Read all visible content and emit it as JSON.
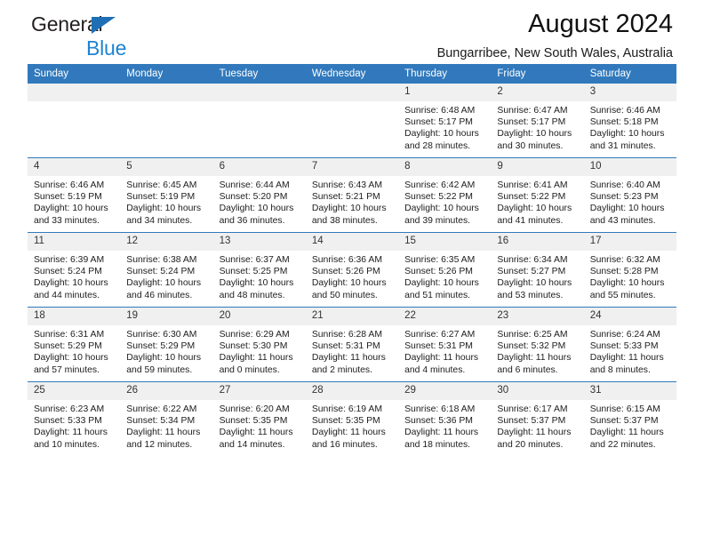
{
  "brand": {
    "name_part1": "General",
    "name_part2": "Blue",
    "logo_icon": "triangle-logo-icon",
    "accent_color": "#1f83d0"
  },
  "header": {
    "title": "August 2024",
    "subtitle": "Bungarribee, New South Wales, Australia"
  },
  "calendar": {
    "header_background": "#3179bc",
    "daynum_background": "#f0f0f0",
    "weekday_headers": [
      "Sunday",
      "Monday",
      "Tuesday",
      "Wednesday",
      "Thursday",
      "Friday",
      "Saturday"
    ],
    "labels": {
      "sunrise_prefix": "Sunrise: ",
      "sunset_prefix": "Sunset: ",
      "daylight_prefix": "Daylight: "
    },
    "weeks": [
      [
        {
          "day": "",
          "sunrise": "",
          "sunset": "",
          "daylight": "",
          "blank": true
        },
        {
          "day": "",
          "sunrise": "",
          "sunset": "",
          "daylight": "",
          "blank": true
        },
        {
          "day": "",
          "sunrise": "",
          "sunset": "",
          "daylight": "",
          "blank": true
        },
        {
          "day": "",
          "sunrise": "",
          "sunset": "",
          "daylight": "",
          "blank": true
        },
        {
          "day": "1",
          "sunrise": "Sunrise: 6:48 AM",
          "sunset": "Sunset: 5:17 PM",
          "daylight": "Daylight: 10 hours and 28 minutes."
        },
        {
          "day": "2",
          "sunrise": "Sunrise: 6:47 AM",
          "sunset": "Sunset: 5:17 PM",
          "daylight": "Daylight: 10 hours and 30 minutes."
        },
        {
          "day": "3",
          "sunrise": "Sunrise: 6:46 AM",
          "sunset": "Sunset: 5:18 PM",
          "daylight": "Daylight: 10 hours and 31 minutes."
        }
      ],
      [
        {
          "day": "4",
          "sunrise": "Sunrise: 6:46 AM",
          "sunset": "Sunset: 5:19 PM",
          "daylight": "Daylight: 10 hours and 33 minutes."
        },
        {
          "day": "5",
          "sunrise": "Sunrise: 6:45 AM",
          "sunset": "Sunset: 5:19 PM",
          "daylight": "Daylight: 10 hours and 34 minutes."
        },
        {
          "day": "6",
          "sunrise": "Sunrise: 6:44 AM",
          "sunset": "Sunset: 5:20 PM",
          "daylight": "Daylight: 10 hours and 36 minutes."
        },
        {
          "day": "7",
          "sunrise": "Sunrise: 6:43 AM",
          "sunset": "Sunset: 5:21 PM",
          "daylight": "Daylight: 10 hours and 38 minutes."
        },
        {
          "day": "8",
          "sunrise": "Sunrise: 6:42 AM",
          "sunset": "Sunset: 5:22 PM",
          "daylight": "Daylight: 10 hours and 39 minutes."
        },
        {
          "day": "9",
          "sunrise": "Sunrise: 6:41 AM",
          "sunset": "Sunset: 5:22 PM",
          "daylight": "Daylight: 10 hours and 41 minutes."
        },
        {
          "day": "10",
          "sunrise": "Sunrise: 6:40 AM",
          "sunset": "Sunset: 5:23 PM",
          "daylight": "Daylight: 10 hours and 43 minutes."
        }
      ],
      [
        {
          "day": "11",
          "sunrise": "Sunrise: 6:39 AM",
          "sunset": "Sunset: 5:24 PM",
          "daylight": "Daylight: 10 hours and 44 minutes."
        },
        {
          "day": "12",
          "sunrise": "Sunrise: 6:38 AM",
          "sunset": "Sunset: 5:24 PM",
          "daylight": "Daylight: 10 hours and 46 minutes."
        },
        {
          "day": "13",
          "sunrise": "Sunrise: 6:37 AM",
          "sunset": "Sunset: 5:25 PM",
          "daylight": "Daylight: 10 hours and 48 minutes."
        },
        {
          "day": "14",
          "sunrise": "Sunrise: 6:36 AM",
          "sunset": "Sunset: 5:26 PM",
          "daylight": "Daylight: 10 hours and 50 minutes."
        },
        {
          "day": "15",
          "sunrise": "Sunrise: 6:35 AM",
          "sunset": "Sunset: 5:26 PM",
          "daylight": "Daylight: 10 hours and 51 minutes."
        },
        {
          "day": "16",
          "sunrise": "Sunrise: 6:34 AM",
          "sunset": "Sunset: 5:27 PM",
          "daylight": "Daylight: 10 hours and 53 minutes."
        },
        {
          "day": "17",
          "sunrise": "Sunrise: 6:32 AM",
          "sunset": "Sunset: 5:28 PM",
          "daylight": "Daylight: 10 hours and 55 minutes."
        }
      ],
      [
        {
          "day": "18",
          "sunrise": "Sunrise: 6:31 AM",
          "sunset": "Sunset: 5:29 PM",
          "daylight": "Daylight: 10 hours and 57 minutes."
        },
        {
          "day": "19",
          "sunrise": "Sunrise: 6:30 AM",
          "sunset": "Sunset: 5:29 PM",
          "daylight": "Daylight: 10 hours and 59 minutes."
        },
        {
          "day": "20",
          "sunrise": "Sunrise: 6:29 AM",
          "sunset": "Sunset: 5:30 PM",
          "daylight": "Daylight: 11 hours and 0 minutes."
        },
        {
          "day": "21",
          "sunrise": "Sunrise: 6:28 AM",
          "sunset": "Sunset: 5:31 PM",
          "daylight": "Daylight: 11 hours and 2 minutes."
        },
        {
          "day": "22",
          "sunrise": "Sunrise: 6:27 AM",
          "sunset": "Sunset: 5:31 PM",
          "daylight": "Daylight: 11 hours and 4 minutes."
        },
        {
          "day": "23",
          "sunrise": "Sunrise: 6:25 AM",
          "sunset": "Sunset: 5:32 PM",
          "daylight": "Daylight: 11 hours and 6 minutes."
        },
        {
          "day": "24",
          "sunrise": "Sunrise: 6:24 AM",
          "sunset": "Sunset: 5:33 PM",
          "daylight": "Daylight: 11 hours and 8 minutes."
        }
      ],
      [
        {
          "day": "25",
          "sunrise": "Sunrise: 6:23 AM",
          "sunset": "Sunset: 5:33 PM",
          "daylight": "Daylight: 11 hours and 10 minutes."
        },
        {
          "day": "26",
          "sunrise": "Sunrise: 6:22 AM",
          "sunset": "Sunset: 5:34 PM",
          "daylight": "Daylight: 11 hours and 12 minutes."
        },
        {
          "day": "27",
          "sunrise": "Sunrise: 6:20 AM",
          "sunset": "Sunset: 5:35 PM",
          "daylight": "Daylight: 11 hours and 14 minutes."
        },
        {
          "day": "28",
          "sunrise": "Sunrise: 6:19 AM",
          "sunset": "Sunset: 5:35 PM",
          "daylight": "Daylight: 11 hours and 16 minutes."
        },
        {
          "day": "29",
          "sunrise": "Sunrise: 6:18 AM",
          "sunset": "Sunset: 5:36 PM",
          "daylight": "Daylight: 11 hours and 18 minutes."
        },
        {
          "day": "30",
          "sunrise": "Sunrise: 6:17 AM",
          "sunset": "Sunset: 5:37 PM",
          "daylight": "Daylight: 11 hours and 20 minutes."
        },
        {
          "day": "31",
          "sunrise": "Sunrise: 6:15 AM",
          "sunset": "Sunset: 5:37 PM",
          "daylight": "Daylight: 11 hours and 22 minutes."
        }
      ]
    ]
  }
}
